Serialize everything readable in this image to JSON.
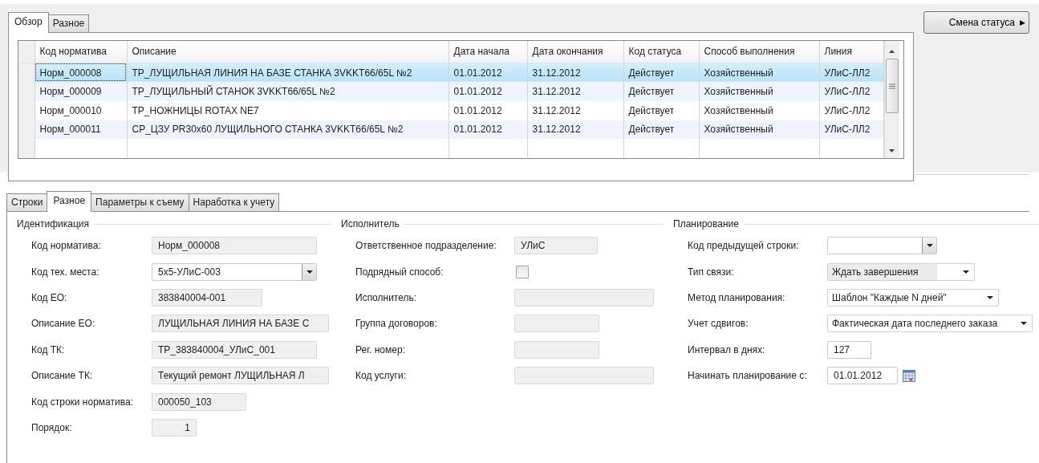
{
  "top_tabs": [
    {
      "label": "Обзор",
      "selected": true
    },
    {
      "label": "Разное",
      "selected": false
    }
  ],
  "status_button": {
    "label": "Смена статуса",
    "arrow": "▶"
  },
  "table": {
    "columns": [
      "Код норматива",
      "Описание",
      "Дата начала",
      "Дата окончания",
      "Код статуса",
      "Способ выполнения",
      "Линия"
    ],
    "rows": [
      {
        "selected": true,
        "cells": [
          "Норм_000008",
          "ТР_ЛУЩИЛЬНАЯ ЛИНИЯ НА БАЗЕ СТАНКА 3VKKT66/65L №2",
          "01.01.2012",
          "31.12.2012",
          "Действует",
          "Хозяйственный",
          "УЛиС-ЛЛ2"
        ]
      },
      {
        "selected": false,
        "cells": [
          "Норм_000009",
          "ТР_ЛУЩИЛЬНЫЙ СТАНОК 3VKKT66/65L №2",
          "01.01.2012",
          "31.12.2012",
          "Действует",
          "Хозяйственный",
          "УЛиС-ЛЛ2"
        ]
      },
      {
        "selected": false,
        "cells": [
          "Норм_000010",
          "ТР_НОЖНИЦЫ ROTAX NE7",
          "01.01.2012",
          "31.12.2012",
          "Действует",
          "Хозяйственный",
          "УЛиС-ЛЛ2"
        ]
      },
      {
        "selected": false,
        "cells": [
          "Норм_000011",
          "СР_ЦЗУ PR30x60 ЛУЩИЛЬНОГО СТАНКА 3VKKT66/65L №2",
          "01.01.2012",
          "31.12.2012",
          "Действует",
          "Хозяйственный",
          "УЛиС-ЛЛ2"
        ]
      }
    ]
  },
  "bottom_tabs": [
    {
      "label": "Строки",
      "selected": false
    },
    {
      "label": "Разное",
      "selected": true
    },
    {
      "label": "Параметры к съему",
      "selected": false
    },
    {
      "label": "Наработка к учету",
      "selected": false
    }
  ],
  "sections": [
    {
      "title": "Идентификация",
      "fields": [
        {
          "kind": "text",
          "label": "Код норматива:",
          "value": "Норм_000008"
        },
        {
          "kind": "combo",
          "label": "Код тех. места:",
          "value": "5x5-УЛиС-003"
        },
        {
          "kind": "text",
          "label": "Код ЕО:",
          "value": "383840004-001"
        },
        {
          "kind": "text",
          "label": "Описание ЕО:",
          "value": "ЛУЩИЛЬНАЯ ЛИНИЯ НА БАЗЕ С"
        },
        {
          "kind": "text",
          "label": "Код ТК:",
          "value": "ТР_383840004_УЛиС_001"
        },
        {
          "kind": "text",
          "label": "Описание ТК:",
          "value": "Текущий ремонт ЛУЩИЛЬНАЯ Л"
        },
        {
          "kind": "text",
          "label": "Код строки норматива:",
          "value": "000050_103"
        },
        {
          "kind": "number",
          "label": "Порядок:",
          "value": "1"
        }
      ]
    },
    {
      "title": "Исполнитель",
      "fields": [
        {
          "kind": "text",
          "label": "Ответственное подразделение:",
          "value": "УЛиС"
        },
        {
          "kind": "checkbox",
          "label": "Подрядный способ:",
          "checked": false
        },
        {
          "kind": "text",
          "label": "Исполнитель:"
        },
        {
          "kind": "text",
          "label": "Группа договоров:"
        },
        {
          "kind": "text",
          "label": "Рег. номер:"
        },
        {
          "kind": "text",
          "label": "Код услуги:"
        }
      ]
    },
    {
      "title": "Планирование",
      "fields": [
        {
          "kind": "combo",
          "label": "Код предыдущей строки:"
        },
        {
          "kind": "dropdown",
          "label": "Тип связи:",
          "value": "Ждать завершения",
          "readonly": true
        },
        {
          "kind": "dropdown",
          "label": "Метод планирования:",
          "value": "Шаблон \"Каждые N дней\"",
          "readonly": false
        },
        {
          "kind": "dropdown",
          "label": "Учет сдвигов:",
          "value": "Фактическая дата последнего заказа",
          "readonly": false
        },
        {
          "kind": "input",
          "label": "Интервал в днях:",
          "value": "127"
        },
        {
          "kind": "date",
          "label": "Начинать планирование с:",
          "value": "01.01.2012"
        }
      ]
    }
  ]
}
